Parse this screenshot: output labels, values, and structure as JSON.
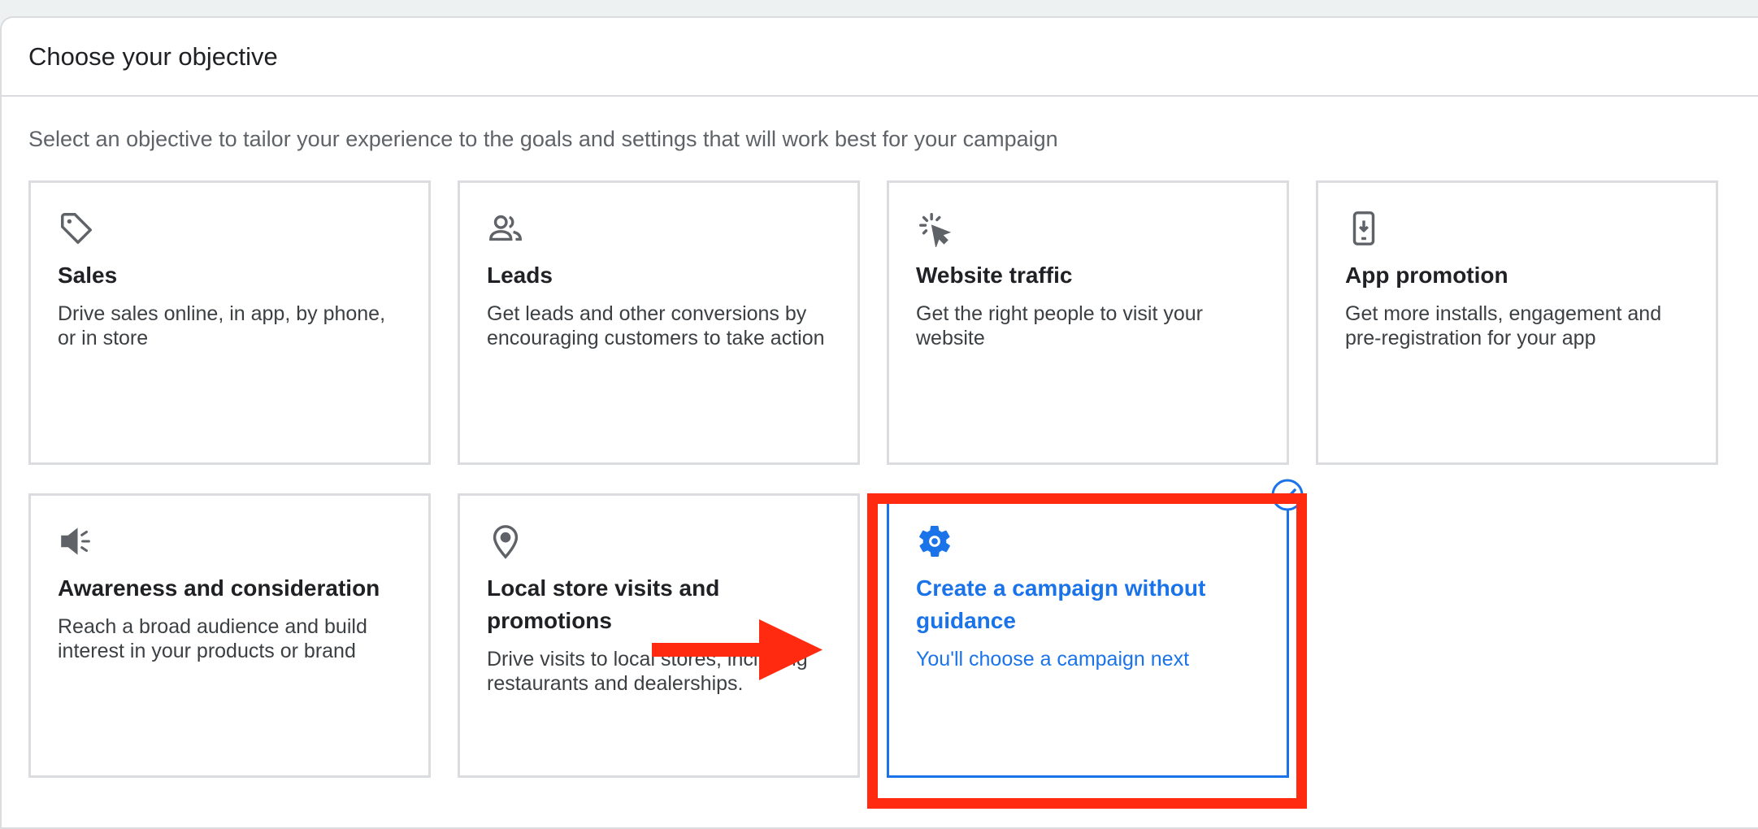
{
  "header": {
    "title": "Choose your objective"
  },
  "subtitle": "Select an objective to tailor your experience to the goals and settings that will work best for your campaign",
  "colors": {
    "accent": "#1a73e8",
    "highlight": "#ff2a0f",
    "border": "#dadce0",
    "text": "#202124",
    "muted": "#5f6368"
  },
  "objectives": [
    {
      "icon": "tag-icon",
      "title": "Sales",
      "desc": "Drive sales online, in app, by phone, or in store"
    },
    {
      "icon": "people-icon",
      "title": "Leads",
      "desc": "Get leads and other conversions by encouraging customers to take action"
    },
    {
      "icon": "cursor-click-icon",
      "title": "Website traffic",
      "desc": "Get the right people to visit your website"
    },
    {
      "icon": "phone-download-icon",
      "title": "App promotion",
      "desc": "Get more installs, engagement and pre-registration for your app"
    },
    {
      "icon": "megaphone-icon",
      "title": "Awareness and consideration",
      "desc": "Reach a broad audience and build interest in your products or brand"
    },
    {
      "icon": "location-pin-icon",
      "title": "Local store visits and promotions",
      "desc": "Drive visits to local stores, including restaurants and dealerships."
    },
    {
      "icon": "gear-icon",
      "title": "Create a campaign without guidance",
      "desc": "You'll choose a campaign next",
      "selected": true
    }
  ]
}
